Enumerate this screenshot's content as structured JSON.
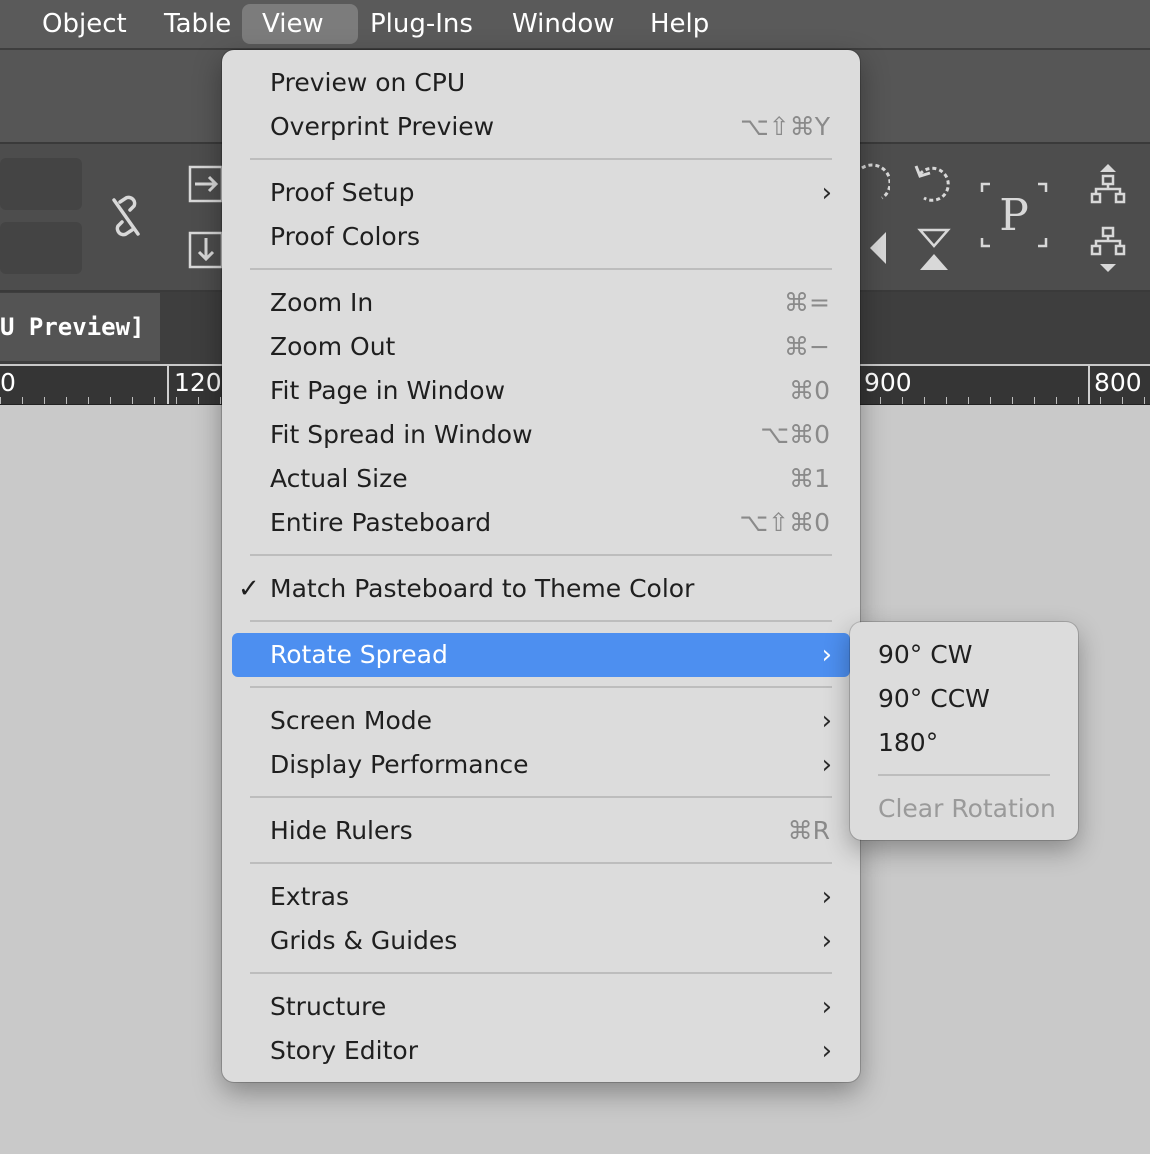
{
  "menubar": {
    "items": [
      "Object",
      "Table",
      "View",
      "Plug-Ins",
      "Window",
      "Help"
    ],
    "active": "View"
  },
  "document": {
    "tab_label": "U Preview]",
    "ruler_labels": [
      "0",
      "120",
      "900",
      "800"
    ]
  },
  "toolbar_icons": [
    "link-broken-icon",
    "align-right-icon",
    "align-bottom-icon",
    "rotate-cw-icon",
    "rotate-ccw-icon",
    "flip-horizontal-icon",
    "flip-vertical-icon",
    "placeholder-p-icon",
    "distribute-up-icon",
    "distribute-down-icon"
  ],
  "view_menu": {
    "items": [
      {
        "label": "Preview on CPU",
        "shortcut": ""
      },
      {
        "label": "Overprint Preview",
        "shortcut": "⌥⇧⌘Y"
      },
      {
        "label": "Proof Setup",
        "submenu": true
      },
      {
        "label": "Proof Colors",
        "shortcut": ""
      },
      {
        "label": "Zoom In",
        "shortcut": "⌘="
      },
      {
        "label": "Zoom Out",
        "shortcut": "⌘−"
      },
      {
        "label": "Fit Page in Window",
        "shortcut": "⌘0"
      },
      {
        "label": "Fit Spread in Window",
        "shortcut": "⌥⌘0"
      },
      {
        "label": "Actual Size",
        "shortcut": "⌘1"
      },
      {
        "label": "Entire Pasteboard",
        "shortcut": "⌥⇧⌘0"
      },
      {
        "label": "Match Pasteboard to Theme Color",
        "checked": true
      },
      {
        "label": "Rotate Spread",
        "submenu": true,
        "highlighted": true
      },
      {
        "label": "Screen Mode",
        "submenu": true
      },
      {
        "label": "Display Performance",
        "submenu": true
      },
      {
        "label": "Hide Rulers",
        "shortcut": "⌘R"
      },
      {
        "label": "Extras",
        "submenu": true
      },
      {
        "label": "Grids & Guides",
        "submenu": true
      },
      {
        "label": "Structure",
        "submenu": true
      },
      {
        "label": "Story Editor",
        "submenu": true
      }
    ],
    "check_glyph": "✓",
    "submenu_glyph": "›"
  },
  "rotate_submenu": {
    "items": [
      {
        "label": "90° CW",
        "enabled": true
      },
      {
        "label": "90° CCW",
        "enabled": true
      },
      {
        "label": "180°",
        "enabled": true
      },
      {
        "label": "Clear Rotation",
        "enabled": false
      }
    ]
  },
  "colors": {
    "menu_bg": "#dcdcdc",
    "highlight": "#4d8ff0",
    "menubar_bg": "#5a5a5a"
  }
}
